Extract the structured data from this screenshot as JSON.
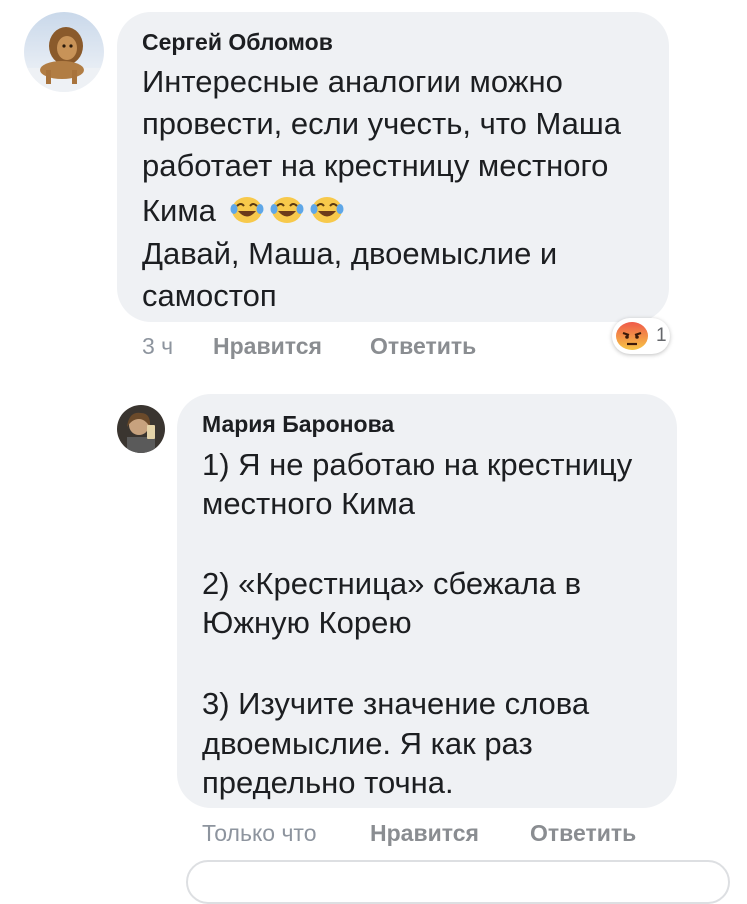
{
  "comments": [
    {
      "author": "Сергей Обломов",
      "lines": [
        "Интересные аналогии можно",
        "провести, если учесть, что Маша",
        "работает на крестницу местного",
        "Кима",
        "Давай, Маша, двоемыслие и",
        "самостоп"
      ],
      "emoji": [
        "tears-of-joy",
        "tears-of-joy",
        "tears-of-joy"
      ],
      "time": "3 ч",
      "like_label": "Нравится",
      "reply_label": "Ответить",
      "reaction": {
        "type": "angry",
        "count": "1"
      },
      "avatar": "lion-photo"
    },
    {
      "author": "Мария Баронова",
      "lines": [
        "1) Я не работаю на крестницу",
        "местного Кима",
        "",
        "2) «Крестница» сбежала в",
        "Южную Корею",
        "",
        "3) Изучите значение слова",
        "двоемыслие. Я как раз",
        "предельно точна."
      ],
      "time": "Только что",
      "like_label": "Нравится",
      "reply_label": "Ответить",
      "avatar": "selfie-photo"
    }
  ],
  "colors": {
    "bubble": "#eff1f4",
    "text": "#1c1e21",
    "meta": "#8d949e",
    "angry_top": "#ef5a4a",
    "angry_bottom": "#f7c545"
  }
}
